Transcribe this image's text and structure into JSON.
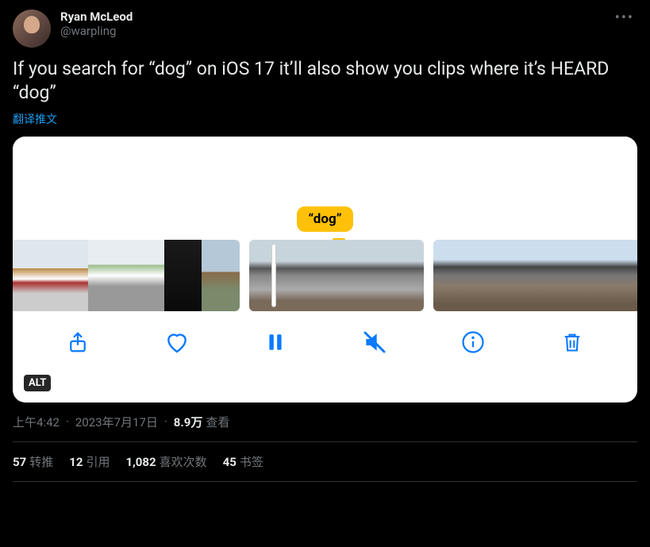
{
  "author": {
    "display_name": "Ryan McLeod",
    "handle": "@warpling"
  },
  "tweet_text": "If you search for “dog” on iOS 17 it’ll also show you clips where it’s HEARD “dog”",
  "translate_label": "翻译推文",
  "media": {
    "search_label": "“dog”",
    "alt_badge": "ALT",
    "toolbar": {
      "share": "share",
      "like": "like",
      "pause": "pause",
      "mute": "mute",
      "info": "info",
      "delete": "delete"
    }
  },
  "meta": {
    "time": "上午4:42",
    "date": "2023年7月17日",
    "views_num": "8.9万",
    "views_label": "查看"
  },
  "stats": {
    "retweets_num": "57",
    "retweets_label": "转推",
    "quotes_num": "12",
    "quotes_label": "引用",
    "likes_num": "1,082",
    "likes_label": "喜欢次数",
    "bookmarks_num": "45",
    "bookmarks_label": "书签"
  }
}
